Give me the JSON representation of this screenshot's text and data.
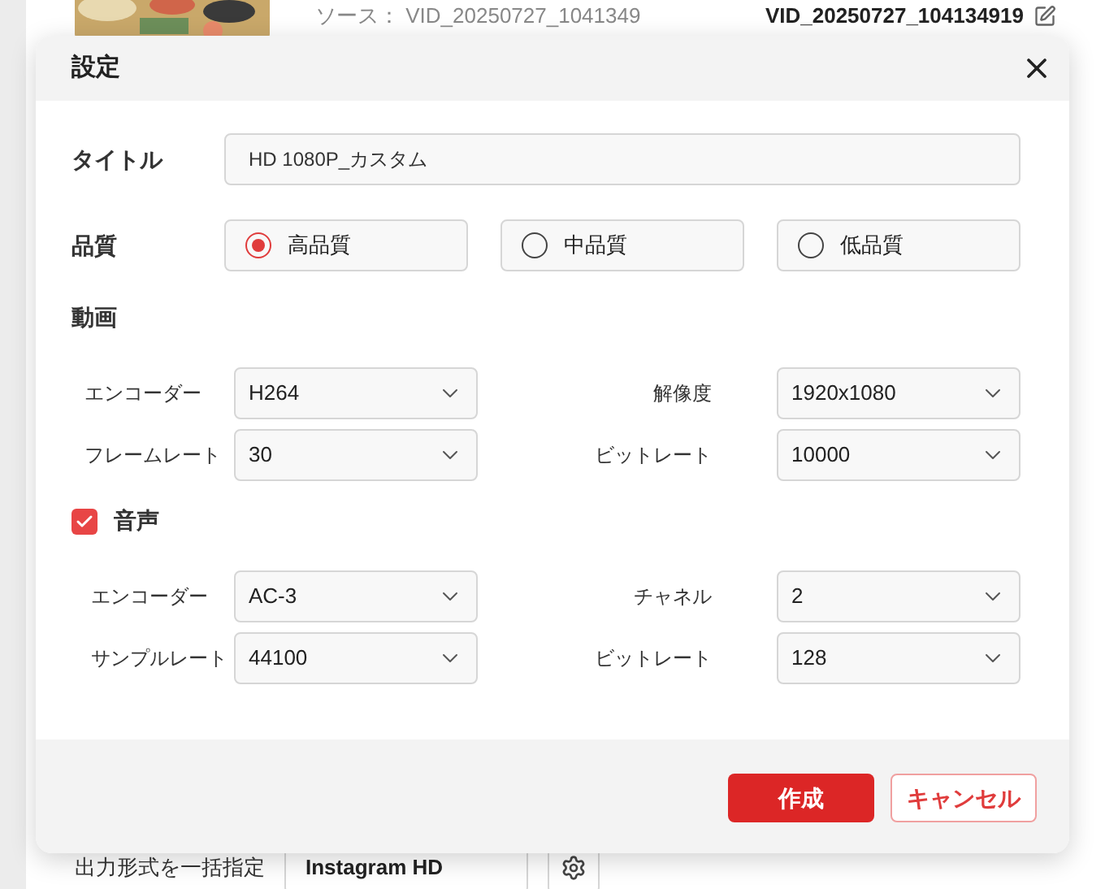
{
  "background": {
    "source_label": "ソース：",
    "source_name": "VID_20250727_1041349",
    "output_name": "VID_20250727_104134919",
    "bulk_format_label": "出力形式を一括指定",
    "bulk_format_value": "Instagram HD"
  },
  "dialog": {
    "title": "設定",
    "title_field": {
      "label": "タイトル",
      "value": "HD 1080P_カスタム"
    },
    "quality": {
      "label": "品質",
      "options": [
        {
          "label": "高品質",
          "selected": true
        },
        {
          "label": "中品質",
          "selected": false
        },
        {
          "label": "低品質",
          "selected": false
        }
      ]
    },
    "video": {
      "label": "動画",
      "fields": [
        {
          "label": "エンコーダー",
          "value": "H264"
        },
        {
          "label": "解像度",
          "value": "1920x1080"
        },
        {
          "label": "フレームレート",
          "value": "30"
        },
        {
          "label": "ビットレート",
          "value": "10000"
        }
      ]
    },
    "audio": {
      "label": "音声",
      "checked": true,
      "fields": [
        {
          "label": "エンコーダー",
          "value": "AC-3"
        },
        {
          "label": "チャネル",
          "value": "2"
        },
        {
          "label": "サンプルレート",
          "value": "44100"
        },
        {
          "label": "ビットレート",
          "value": "128"
        }
      ]
    },
    "buttons": [
      {
        "label": "作成",
        "kind": "primary"
      },
      {
        "label": "キャンセル",
        "kind": "secondary"
      }
    ]
  }
}
